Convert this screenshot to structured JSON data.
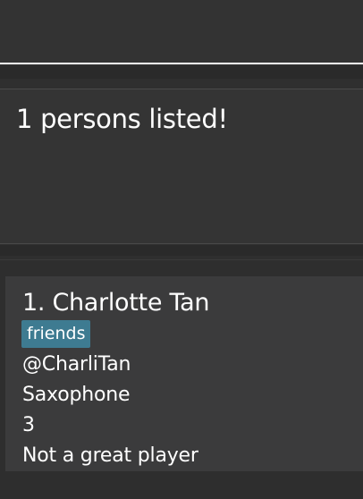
{
  "command": {
    "value": "",
    "placeholder": ""
  },
  "result": {
    "message": "1 persons listed!"
  },
  "persons": [
    {
      "index_name": "1. Charlotte Tan",
      "tags": [
        "friends"
      ],
      "handle": "@CharliTan",
      "instrument": "Saxophone",
      "level": "3",
      "remark": "Not a great player"
    }
  ],
  "colors": {
    "background": "#2f2f2f",
    "card": "#3b3b3c",
    "tag": "#3e7b91",
    "text": "#ffffff",
    "command_underline": "#ffffff"
  }
}
